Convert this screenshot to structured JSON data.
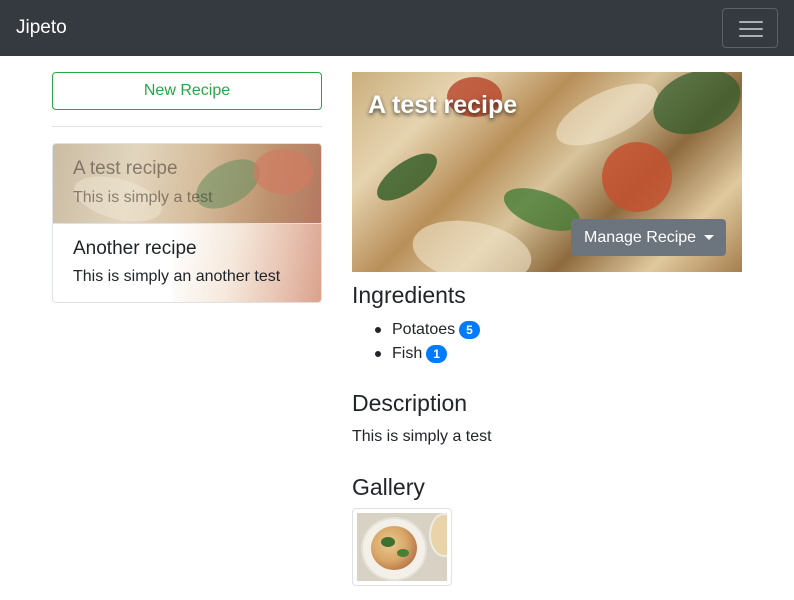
{
  "navbar": {
    "brand": "Jipeto",
    "toggler_icon": "hamburger-menu-icon"
  },
  "sidebar": {
    "new_button_label": "New Recipe",
    "recipes": [
      {
        "title": "A test recipe",
        "description": "This is simply a test"
      },
      {
        "title": "Another recipe",
        "description": "This is simply an another test"
      }
    ]
  },
  "recipe": {
    "title": "A test recipe",
    "manage_button_label": "Manage Recipe",
    "ingredients_heading": "Ingredients",
    "ingredients": [
      {
        "name": "Potatoes",
        "amount": "5"
      },
      {
        "name": "Fish",
        "amount": "1"
      }
    ],
    "description_heading": "Description",
    "description": "This is simply a test",
    "gallery_heading": "Gallery"
  },
  "colors": {
    "navbar_bg": "#343a40",
    "success": "#28a745",
    "primary_badge": "#007bff",
    "secondary_button": "#6c757d"
  }
}
